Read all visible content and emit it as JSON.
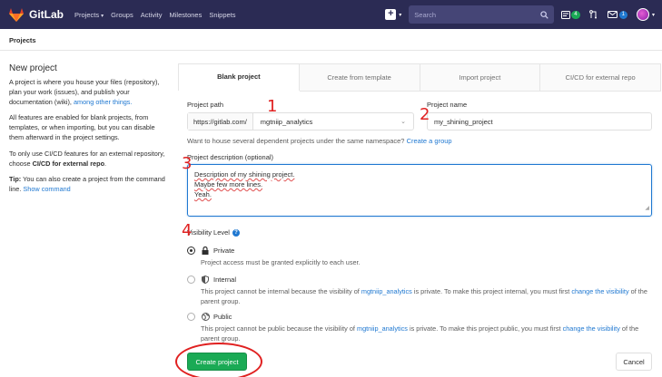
{
  "navbar": {
    "brand": "GitLab",
    "links": [
      {
        "label": "Projects",
        "dropdown": true
      },
      {
        "label": "Groups"
      },
      {
        "label": "Activity"
      },
      {
        "label": "Milestones"
      },
      {
        "label": "Snippets"
      }
    ],
    "search_placeholder": "Search",
    "todo_count": "4",
    "mr_icon": "merge-request-icon",
    "issues_count": "1"
  },
  "breadcrumb": "Projects",
  "sidebar": {
    "title": "New project",
    "intro": "A project is where you house your files (repository), plan your work (issues), and publish your documentation (wiki),",
    "intro_link": "among other things.",
    "features": "All features are enabled for blank projects, from templates, or when importing, but you can disable them afterward in the project settings.",
    "cicd_prefix": "To only use CI/CD features for an external repository, choose",
    "cicd_bold": "CI/CD for external repo",
    "cicd_suffix": ".",
    "tip_bold": "Tip:",
    "tip_text": "You can also create a project from the command line.",
    "tip_link": "Show command"
  },
  "tabs": [
    {
      "label": "Blank project",
      "active": true
    },
    {
      "label": "Create from template"
    },
    {
      "label": "Import project"
    },
    {
      "label": "CI/CD for external repo"
    }
  ],
  "form": {
    "path_label": "Project path",
    "path_prefix": "https://gitlab.com/",
    "namespace": "mgtniip_analytics",
    "name_label": "Project name",
    "name_value": "my_shining_project",
    "hint_text": "Want to house several dependent projects under the same namespace?",
    "hint_link": "Create a group",
    "desc_label": "Project description (optional)",
    "desc_lines": [
      "Description of my shining project.",
      "Maybe few more lines.",
      "Yeah."
    ],
    "visibility_label": "Visibility Level",
    "options": [
      {
        "name": "Private",
        "desc": "Project access must be granted explicitly to each user.",
        "selected": true
      },
      {
        "name": "Internal",
        "desc_a": "This project cannot be internal because the visibility of",
        "desc_group": "mgtniip_analytics",
        "desc_b": "is private. To make this project internal, you must first",
        "desc_link": "change the visibility",
        "desc_c": "of the parent group."
      },
      {
        "name": "Public",
        "desc_a": "This project cannot be public because the visibility of",
        "desc_group": "mgtniip_analytics",
        "desc_b": "is private. To make this project public, you must first",
        "desc_link": "change the visibility",
        "desc_c": "of the parent group."
      }
    ],
    "create_label": "Create project",
    "cancel_label": "Cancel"
  },
  "annotations": [
    "1",
    "2",
    "3",
    "4"
  ],
  "colors": {
    "navbar": "#2b2b54",
    "accent": "#1f78d1",
    "success": "#1aaa55",
    "annotation": "#e02020"
  }
}
